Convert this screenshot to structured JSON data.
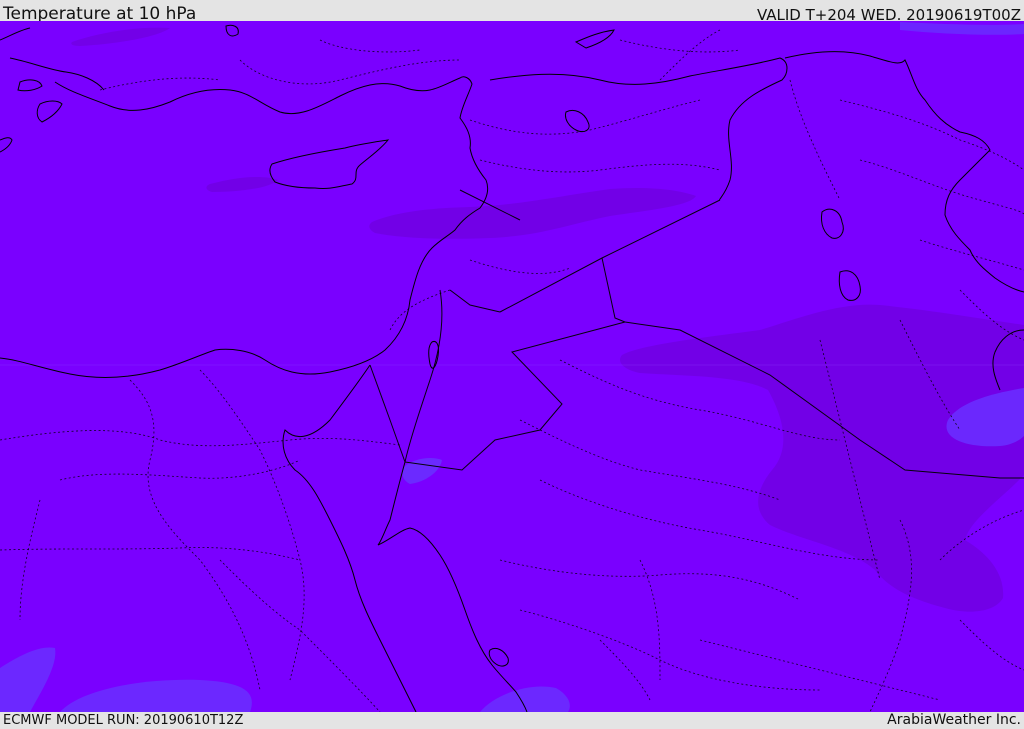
{
  "header": {
    "title": "Temperature at 10 hPa",
    "valid_time": "VALID T+204 WED. 20190619T00Z"
  },
  "footer": {
    "model_run": "ECMWF MODEL RUN: 20190610T12Z",
    "credit": "ArabiaWeather Inc."
  },
  "map": {
    "base_fill_color": "#7a00ff",
    "warm_patch_color": "#7200e6",
    "cool_patch_color": "#6a2cff",
    "coastline_color": "#000000",
    "border_color": "#000000"
  }
}
